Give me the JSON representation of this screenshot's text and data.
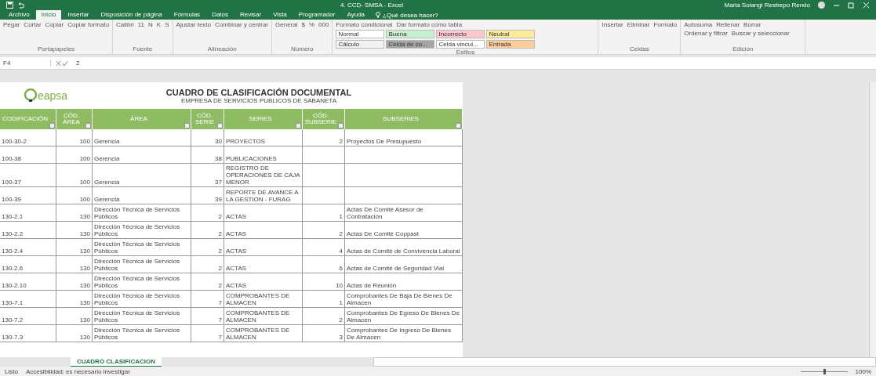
{
  "window": {
    "title": "4. CCD- SMSA - Excel",
    "user": "Maria Solangi Restrepo Rendo"
  },
  "tabs": [
    {
      "label": "Archivo",
      "selected": false
    },
    {
      "label": "Inicio",
      "selected": true
    },
    {
      "label": "Insertar",
      "selected": false
    },
    {
      "label": "Disposición de página",
      "selected": false
    },
    {
      "label": "Fórmulas",
      "selected": false
    },
    {
      "label": "Datos",
      "selected": false
    },
    {
      "label": "Revisar",
      "selected": false
    },
    {
      "label": "Vista",
      "selected": false
    },
    {
      "label": "Programador",
      "selected": false
    },
    {
      "label": "Ayuda",
      "selected": false
    }
  ],
  "tell_me": {
    "placeholder": "¿Qué desea hacer?"
  },
  "ribbon": {
    "groups": [
      {
        "label": "Portapapeles",
        "items": [
          "Pegar",
          "Cortar",
          "Copiar",
          "Copiar formato"
        ]
      },
      {
        "label": "Fuente",
        "items": [
          "Calibri",
          "11",
          "N",
          "K",
          "S"
        ]
      },
      {
        "label": "Alineación",
        "items": [
          "Ajustar texto",
          "Combinar y centrar"
        ]
      },
      {
        "label": "Número",
        "items": [
          "General",
          "$",
          "%",
          "000"
        ]
      },
      {
        "label": "Estilos",
        "items": [
          "Formato condicional",
          "Dar formato como tabla"
        ],
        "styles": [
          {
            "label": "Normal",
            "color": "#ffffff"
          },
          {
            "label": "Buena",
            "color": "#c6efce"
          },
          {
            "label": "Incorrecto",
            "color": "#ffc7ce"
          },
          {
            "label": "Neutral",
            "color": "#ffeb9c"
          },
          {
            "label": "Cálculo",
            "color": "#f2f2f2"
          },
          {
            "label": "Celda de co...",
            "color": "#a5a5a5"
          },
          {
            "label": "Celda vincul...",
            "color": "#ffffff"
          },
          {
            "label": "Entrada",
            "color": "#ffcc99"
          }
        ]
      },
      {
        "label": "Celdas",
        "items": [
          "Insertar",
          "Eliminar",
          "Formato"
        ]
      },
      {
        "label": "Edición",
        "items": [
          "Autosuma",
          "Rellenar",
          "Borrar",
          "Ordenar y filtrar",
          "Buscar y seleccionar"
        ]
      }
    ]
  },
  "formula_bar": {
    "name_box": "F4",
    "value": "2"
  },
  "sheet": {
    "title": "CUADRO DE CLASIFICACIÓN DOCUMENTAL",
    "subtitle": "EMPRESA DE SERVICIOS PUBLICOS DE SABANETA",
    "logo_text": "eapsa",
    "columns": [
      "CODIFICACIÓN",
      "CÓD. ÁREA",
      "ÁREA",
      "CÓD. SERIE",
      "SERIES",
      "CÓD. SUBSERIE",
      "SUBSERIES"
    ],
    "rows": [
      [
        "100-30-2",
        "100",
        "Gerencia",
        "30",
        "PROYECTOS",
        "2",
        "Proyectos De Presupuesto"
      ],
      [
        "100-38",
        "100",
        "Gerencia",
        "38",
        "PUBLICACIONES",
        "",
        ""
      ],
      [
        "100-37",
        "100",
        "Gerencia",
        "37",
        "REGISTRO DE OPERACIONES DE CAJA MENOR",
        "",
        ""
      ],
      [
        "100-39",
        "100",
        "Gerencia",
        "39",
        "REPORTE DE AVANCE A LA GESTION - FURAG",
        "",
        ""
      ],
      [
        "130-2.1",
        "130",
        "Dirección Técnica de Servicios Públicos",
        "2",
        "ACTAS",
        "1",
        "Actas De Comité Asesor de Contratación"
      ],
      [
        "130-2.2",
        "130",
        "Dirección Técnica de Servicios Públicos",
        "2",
        "ACTAS",
        "2",
        "Actas De Comité Coppast"
      ],
      [
        "130-2.4",
        "130",
        "Dirección Técnica de Servicios Públicos",
        "2",
        "ACTAS",
        "4",
        "Actas de Comité de Convivencia Laboral"
      ],
      [
        "130-2.6",
        "130",
        "Dirección Técnica de Servicios Públicos",
        "2",
        "ACTAS",
        "6",
        "Actas de Comité de Seguridad Vial"
      ],
      [
        "130-2.10",
        "130",
        "Dirección Técnica de Servicios Públicos",
        "2",
        "ACTAS",
        "10",
        "Actas de Reunión"
      ],
      [
        "130-7.1",
        "130",
        "Dirección Técnica de Servicios Públicos",
        "7",
        "COMPROBANTES DE ALMACEN",
        "1",
        "Comprobantes De Baja De Bienes De Almacen"
      ],
      [
        "130-7.2",
        "130",
        "Dirección Técnica de Servicios Públicos",
        "7",
        "COMPROBANTES DE ALMACEN",
        "2",
        "Comprobantes De Egreso De Bienes De Almacen"
      ],
      [
        "130-7.3",
        "130",
        "Dirección Técnica de Servicios Públicos",
        "7",
        "COMPROBANTES DE ALMACEN",
        "3",
        "Comprobantes De Ingreso De Bienes De Almacen"
      ]
    ]
  },
  "sheet_tabs": [
    {
      "label": "CUADRO CLASIFICACION",
      "selected": true
    }
  ],
  "status_bar": {
    "status": "Listo",
    "accessibility": "Accesibilidad: es necesario investigar",
    "zoom": "100%",
    "zoom_slider": {
      "level": 0.5
    }
  }
}
